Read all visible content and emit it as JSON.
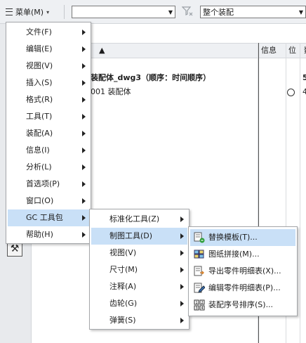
{
  "toolbar": {
    "menu_label": "菜单(M)",
    "combo1_value": "",
    "combo2_value": "整个装配"
  },
  "table": {
    "headers": {
      "info": "信息",
      "pos": "位",
      "last": "数"
    },
    "rows": [
      {
        "name": "装配体_dwg3（顺序：时间顺序）",
        "last": "5"
      },
      {
        "name": "001 装配体",
        "last": "4"
      }
    ]
  },
  "main_menu": {
    "items": [
      {
        "label": "文件(F)"
      },
      {
        "label": "编辑(E)"
      },
      {
        "label": "视图(V)"
      },
      {
        "label": "插入(S)"
      },
      {
        "label": "格式(R)"
      },
      {
        "label": "工具(T)"
      },
      {
        "label": "装配(A)"
      },
      {
        "label": "信息(I)"
      },
      {
        "label": "分析(L)"
      },
      {
        "label": "首选项(P)"
      },
      {
        "label": "窗口(O)"
      },
      {
        "label": "GC 工具包"
      },
      {
        "label": "帮助(H)"
      }
    ]
  },
  "gc_menu": {
    "items": [
      {
        "label": "标准化工具(Z)"
      },
      {
        "label": "制图工具(D)"
      },
      {
        "label": "视图(V)"
      },
      {
        "label": "尺寸(M)"
      },
      {
        "label": "注释(A)"
      },
      {
        "label": "齿轮(G)"
      },
      {
        "label": "弹簧(S)"
      }
    ]
  },
  "drafting_menu": {
    "items": [
      {
        "label": "替换模板(T)...",
        "icon": "replace-template-icon"
      },
      {
        "label": "图纸拼接(M)...",
        "icon": "sheet-stitch-icon"
      },
      {
        "label": "导出零件明细表(X)...",
        "icon": "export-parts-list-icon"
      },
      {
        "label": "编辑零件明细表(P)...",
        "icon": "edit-parts-list-icon"
      },
      {
        "label": "装配序号排序(S)...",
        "icon": "sort-balloons-icon"
      }
    ]
  },
  "colors": {
    "highlight": "#c9e0f7",
    "toolbar_bg": "#eef0f3",
    "menu_border": "#a5a7aa"
  }
}
